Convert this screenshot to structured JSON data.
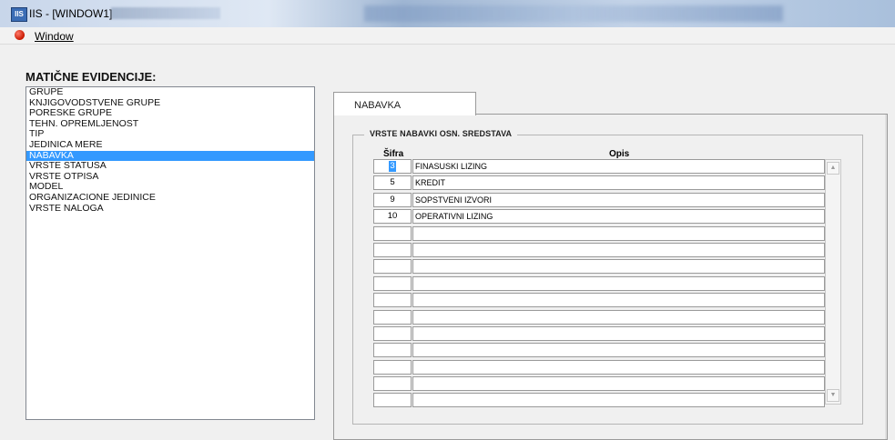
{
  "window": {
    "title": "IIS - [WINDOW1]",
    "app_icon_text": "IIS"
  },
  "menu": {
    "items": [
      {
        "label": "Window",
        "icon": "red-circle-icon"
      }
    ]
  },
  "left_panel": {
    "title": "MATIČNE EVIDENCIJE:",
    "items": [
      {
        "label": "GRUPE",
        "selected": false
      },
      {
        "label": "KNJIGOVODSTVENE GRUPE",
        "selected": false
      },
      {
        "label": "PORESKE GRUPE",
        "selected": false
      },
      {
        "label": "TEHN. OPREMLJENOST",
        "selected": false
      },
      {
        "label": "TIP",
        "selected": false
      },
      {
        "label": "JEDINICA MERE",
        "selected": false
      },
      {
        "label": "NABAVKA",
        "selected": true
      },
      {
        "label": "VRSTE STATUSA",
        "selected": false
      },
      {
        "label": "VRSTE OTPISA",
        "selected": false
      },
      {
        "label": "MODEL",
        "selected": false
      },
      {
        "label": "ORGANIZACIONE JEDINICE",
        "selected": false
      },
      {
        "label": "VRSTE NALOGA",
        "selected": false
      }
    ]
  },
  "tab": {
    "label": "NABAVKA"
  },
  "group": {
    "title": "VRSTE NABAVKI OSN. SREDSTAVA",
    "columns": {
      "code": "Šifra",
      "description": "Opis"
    },
    "rows": [
      {
        "code": "3",
        "description": "FINASUSKI LIZING",
        "focused": true
      },
      {
        "code": "5",
        "description": "KREDIT"
      },
      {
        "code": "9",
        "description": "SOPSTVENI IZVORI"
      },
      {
        "code": "10",
        "description": "OPERATIVNI LIZING"
      },
      {
        "code": "",
        "description": ""
      },
      {
        "code": "",
        "description": ""
      },
      {
        "code": "",
        "description": ""
      },
      {
        "code": "",
        "description": ""
      },
      {
        "code": "",
        "description": ""
      },
      {
        "code": "",
        "description": ""
      },
      {
        "code": "",
        "description": ""
      },
      {
        "code": "",
        "description": ""
      },
      {
        "code": "",
        "description": ""
      },
      {
        "code": "",
        "description": ""
      },
      {
        "code": "",
        "description": ""
      }
    ]
  },
  "colors": {
    "selection": "#3399ff",
    "menu_icon": "#c81800"
  }
}
